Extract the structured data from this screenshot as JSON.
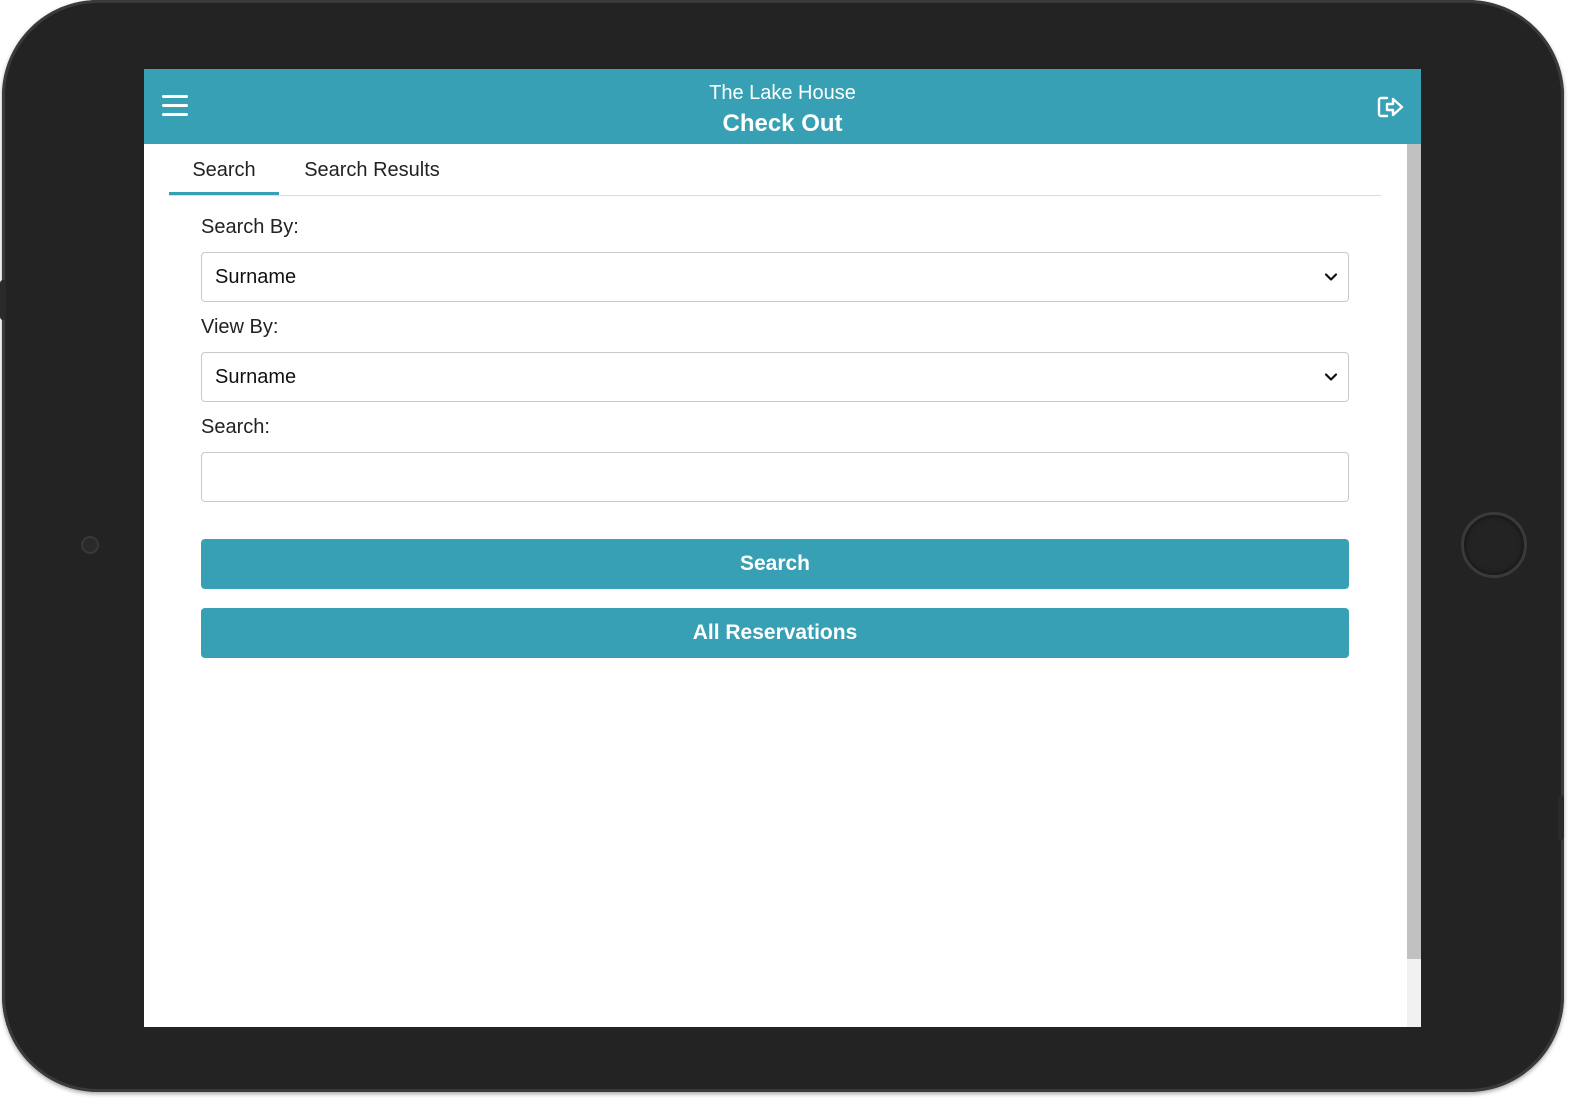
{
  "header": {
    "property_name": "The Lake House",
    "page_title": "Check Out",
    "menu_icon": "hamburger-menu-icon",
    "logout_icon": "logout-icon"
  },
  "tabs": [
    {
      "label": "Search",
      "active": true
    },
    {
      "label": "Search Results",
      "active": false
    }
  ],
  "form": {
    "search_by": {
      "label": "Search By:",
      "value": "Surname"
    },
    "view_by": {
      "label": "View By:",
      "value": "Surname"
    },
    "search": {
      "label": "Search:",
      "value": "",
      "placeholder": ""
    }
  },
  "buttons": {
    "search": "Search",
    "all_reservations": "All Reservations"
  },
  "colors": {
    "accent": "#38a0b4",
    "bezel": "#232323"
  }
}
